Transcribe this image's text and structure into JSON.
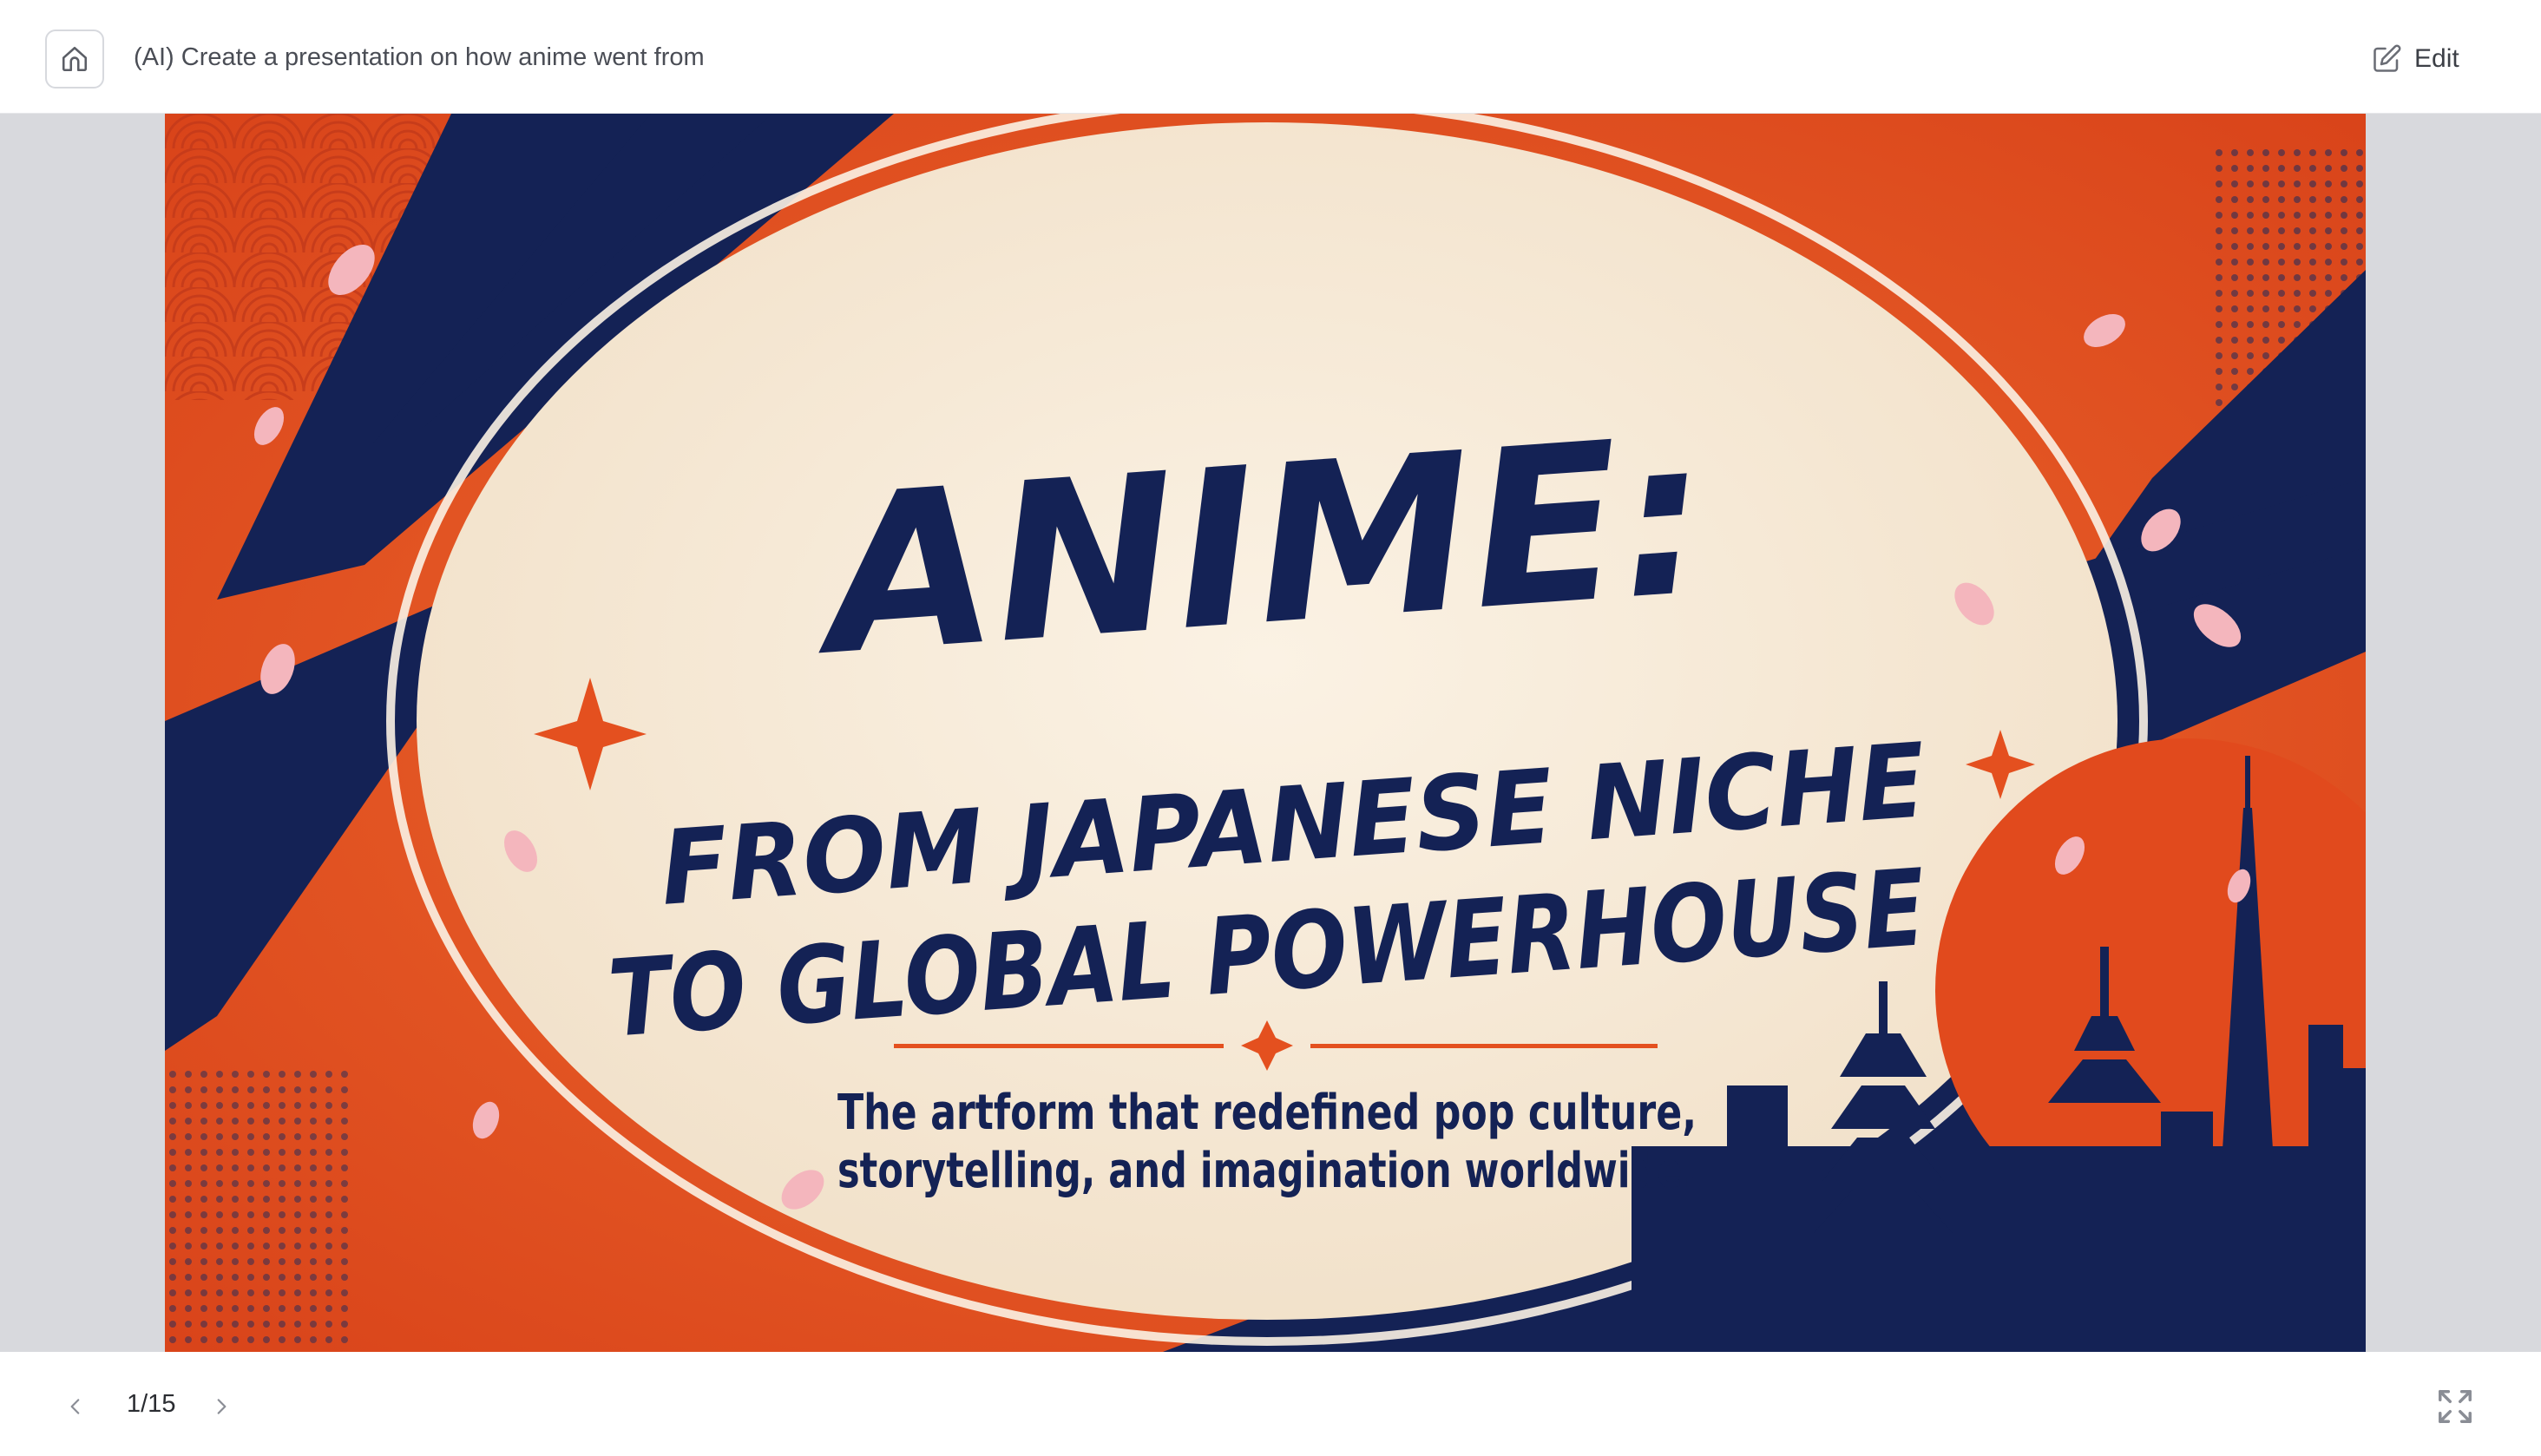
{
  "header": {
    "title": "(AI) Create a presentation on how anime went from",
    "edit_label": "Edit",
    "home_icon": "home-icon",
    "edit_icon": "edit-icon"
  },
  "slide": {
    "title_line1": "ANIME:",
    "title_line2": "FROM JAPANESE NICHE",
    "title_line3": "TO GLOBAL POWERHOUSE",
    "subtitle_line1": "The artform that redefined pop culture,",
    "subtitle_line2": "storytelling, and imagination worldwide.",
    "colors": {
      "orange": "#e4501f",
      "navy": "#142255",
      "cream": "#f6ead8"
    }
  },
  "footer": {
    "page_indicator": "1/15",
    "prev_icon": "chevron-left-icon",
    "next_icon": "chevron-right-icon",
    "fullscreen_icon": "fullscreen-icon"
  }
}
